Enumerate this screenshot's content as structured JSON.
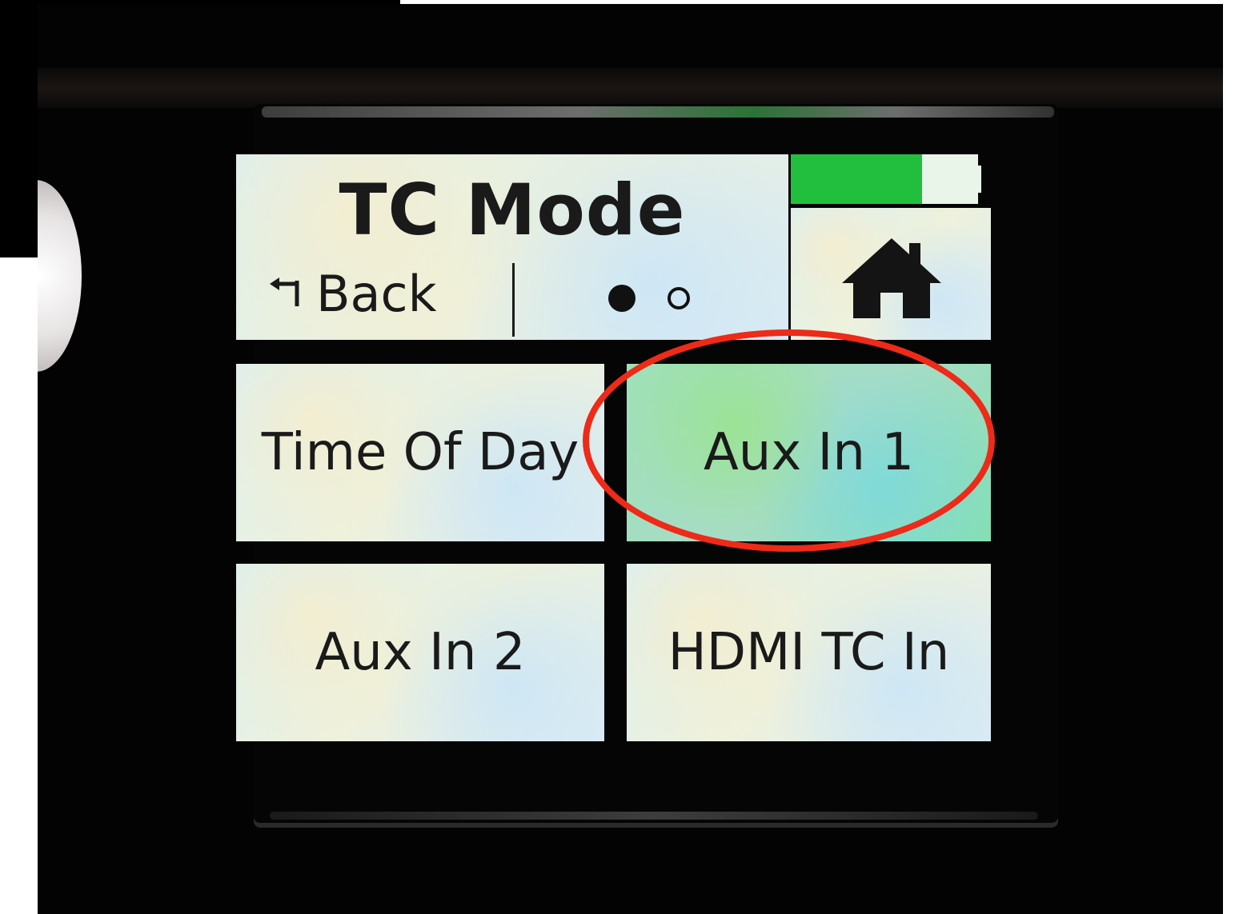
{
  "screen": {
    "title": "TC Mode",
    "back_label": "Back",
    "page_indicator": {
      "current": 1,
      "total": 2
    },
    "battery": {
      "level": 0.7,
      "fill_color": "#22bf3f"
    },
    "home_icon": "home-icon",
    "back_icon": "back-arrow-icon",
    "options": [
      {
        "label": "Time Of Day",
        "selected": false
      },
      {
        "label": "Aux In 1",
        "selected": true
      },
      {
        "label": "Aux In 2",
        "selected": false
      },
      {
        "label": "HDMI TC In",
        "selected": false
      }
    ]
  },
  "annotation": {
    "shape": "ellipse",
    "color": "#ee2a18",
    "target": "Aux In 1"
  }
}
